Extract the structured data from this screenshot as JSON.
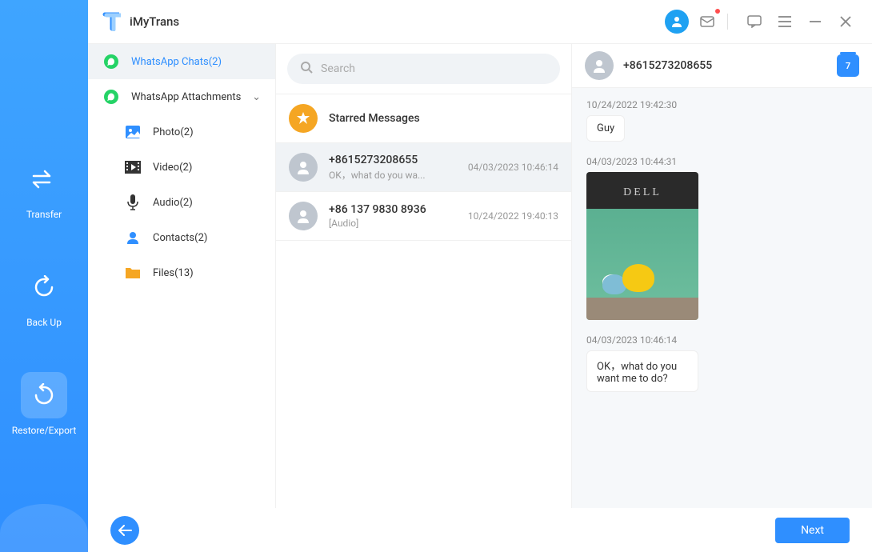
{
  "app": {
    "title": "iMyTrans"
  },
  "rail": {
    "items": [
      {
        "label": "Transfer"
      },
      {
        "label": "Back Up"
      },
      {
        "label": "Restore/Export"
      }
    ]
  },
  "sidebar": {
    "chats_label": "WhatsApp Chats(2)",
    "attachments_label": "WhatsApp Attachments",
    "photo_label": "Photo(2)",
    "video_label": "Video(2)",
    "audio_label": "Audio(2)",
    "contacts_label": "Contacts(2)",
    "files_label": "Files(13)"
  },
  "search": {
    "placeholder": "Search"
  },
  "chatlist": {
    "starred_label": "Starred Messages",
    "items": [
      {
        "title": "+8615273208655",
        "preview": "OK，what do you wa...",
        "time": "04/03/2023 10:46:14"
      },
      {
        "title": "+86 137 9830 8936",
        "preview": "[Audio]",
        "time": "10/24/2022 19:40:13"
      }
    ]
  },
  "conversation": {
    "title": "+8615273208655",
    "calendar_day": "7",
    "messages": [
      {
        "time": "10/24/2022 19:42:30",
        "text": "Guy"
      },
      {
        "time": "04/03/2023 10:44:31",
        "image_label": "DELL"
      },
      {
        "time": "04/03/2023 10:46:14",
        "text": "OK，what do you want me to do?"
      }
    ]
  },
  "footer": {
    "next_label": "Next"
  }
}
